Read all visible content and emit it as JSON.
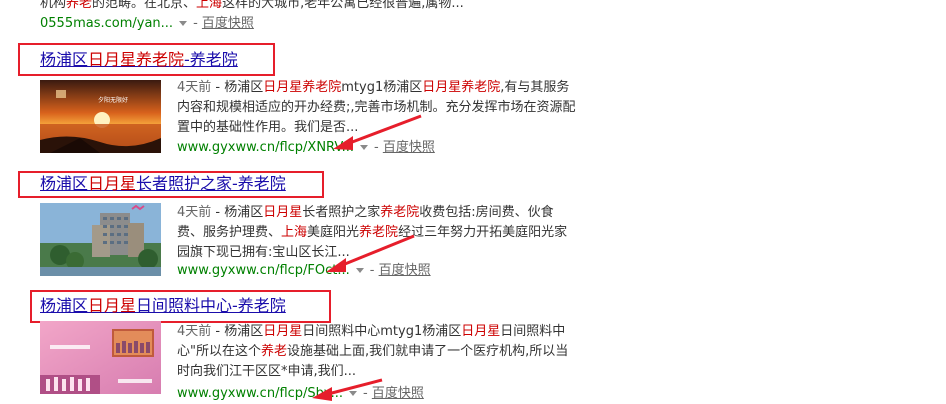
{
  "top_result": {
    "snippet_a": "机构",
    "snippet_b": "养老",
    "snippet_c": "的范畴。在北京、",
    "snippet_d": "上海",
    "snippet_e": "这样的大城市,老年公寓已经很普遍,属物...",
    "url": "0555mas.com/yan...",
    "snapshot": "百度快照"
  },
  "results": [
    {
      "title_a": "杨浦区",
      "title_b": "日月星养老院",
      "title_c": "-养老院",
      "age": "4天前",
      "desc_parts": [
        {
          "t": " - 杨浦区",
          "h": false
        },
        {
          "t": "日月星养老院",
          "h": true
        },
        {
          "t": "mtyg1杨浦区",
          "h": false
        },
        {
          "t": "日月星养老院",
          "h": true
        },
        {
          "t": ",有与其服务内容和规模相适应的开办经费;,完善市场机制。充分发挥市场在资源配置中的基础性作用。我们是否...",
          "h": false
        }
      ],
      "url": "www.gyxww.cn/flcp/XNRV...",
      "snapshot": "百度快照",
      "thumb_caption": "夕阳无限好"
    },
    {
      "title_a": "杨浦区",
      "title_b": "日月星",
      "title_c": "长者照护之家-养老院",
      "age": "4天前",
      "desc_parts": [
        {
          "t": " - 杨浦区",
          "h": false
        },
        {
          "t": "日月星",
          "h": true
        },
        {
          "t": "长者照护之家",
          "h": false
        },
        {
          "t": "养老院",
          "h": true
        },
        {
          "t": "收费包括:房间费、伙食费、服务护理费、",
          "h": false
        },
        {
          "t": "上海",
          "h": true
        },
        {
          "t": "美庭阳光",
          "h": false
        },
        {
          "t": "养老院",
          "h": true
        },
        {
          "t": "经过三年努力开拓美庭阳光家园旗下现已拥有:宝山区长江...",
          "h": false
        }
      ],
      "url": "www.gyxww.cn/flcp/FOct...",
      "snapshot": "百度快照"
    },
    {
      "title_a": "杨浦区",
      "title_b": "日月星",
      "title_c": "日间照料中心-养老院",
      "age": "4天前",
      "desc_parts": [
        {
          "t": " - 杨浦区",
          "h": false
        },
        {
          "t": "日月星",
          "h": true
        },
        {
          "t": "日间照料中心mtyg1杨浦区",
          "h": false
        },
        {
          "t": "日月星",
          "h": true
        },
        {
          "t": "日间照料中心\"所以在这个",
          "h": false
        },
        {
          "t": "养老",
          "h": true
        },
        {
          "t": "设施基础上面,我们就申请了一个医疗机构,所以当时向我们江干区区*申请,我们...",
          "h": false
        }
      ],
      "url": "www.gyxww.cn/flcp/Sbv...",
      "snapshot": "百度快照"
    }
  ],
  "colors": {
    "title_link": "#1a0dab",
    "highlight": "#cc0000",
    "url": "#008000",
    "annotation_red": "#e61e2b"
  }
}
